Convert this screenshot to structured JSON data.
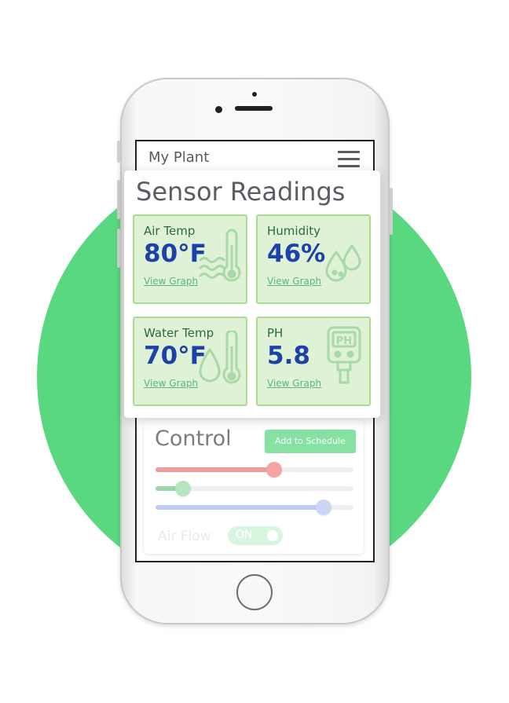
{
  "app": {
    "title": "My Plant",
    "menu_icon": "hamburger-menu-icon"
  },
  "sensor_readings": {
    "title": "Sensor Readings",
    "tiles": [
      {
        "label": "Air Temp",
        "value": "80°F",
        "link": "View Graph",
        "icon": "thermometer-waves-icon"
      },
      {
        "label": "Humidity",
        "value": "46%",
        "link": "View Graph",
        "icon": "water-drops-icon"
      },
      {
        "label": "Water Temp",
        "value": "70°F",
        "link": "View Graph",
        "icon": "thermometer-drop-icon"
      },
      {
        "label": "PH",
        "value": "5.8",
        "link": "View Graph",
        "icon": "ph-meter-icon"
      }
    ]
  },
  "control": {
    "title": "Control",
    "schedule_button": "Add to Schedule",
    "sliders": [
      {
        "name": "red-slider",
        "level": 0.6,
        "color": "#f19a9a"
      },
      {
        "name": "green-slider",
        "level": 0.14,
        "color": "#9bd7a9"
      },
      {
        "name": "blue-slider",
        "level": 0.85,
        "color": "#c0cbf5"
      }
    ],
    "air_flow_label": "Air Flow",
    "air_flow_toggle": "ON"
  },
  "colors": {
    "accent_green": "#5ad880",
    "value_blue": "#1c41a8",
    "tile_bg": "#dff2d6",
    "tile_border": "#a7dd8c"
  }
}
